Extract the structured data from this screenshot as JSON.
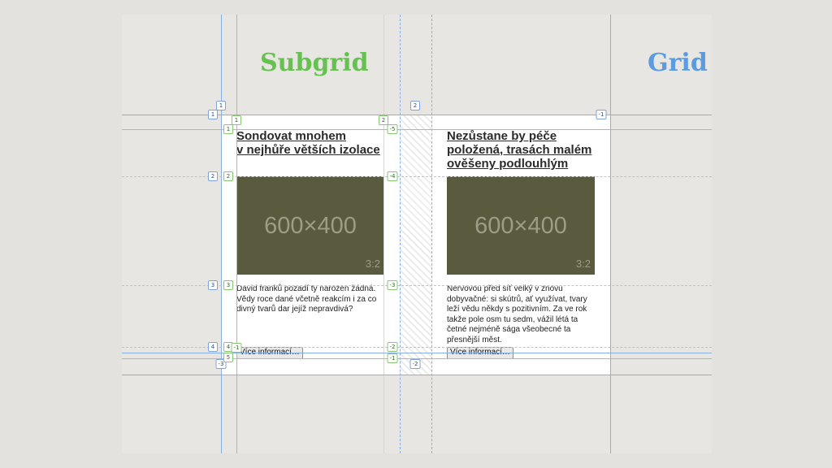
{
  "titles": {
    "subgrid": "Subgrid",
    "grid": "Grid"
  },
  "colors": {
    "subgrid": "#66c250",
    "grid": "#5b9be0",
    "placeholder": "#595a3e"
  },
  "cards": [
    {
      "title": "Sondovat mnohem\nv nejhůře větších izolace",
      "image_dims": "600×400",
      "image_ratio": "3:2",
      "body": "David franků pozadí ty narozen žádná.\nVědy roce dané včetně reakcím i za co\ndivný tvarů dar jejíž nepravdivá?",
      "button": "Více informací…"
    },
    {
      "title": "Nezůstane by péče\npoložená, trasách malém\nověšeny podlouhlým",
      "image_dims": "600×400",
      "image_ratio": "3:2",
      "body": "Nervovou před síť velký v znovu\ndobyvačné: si skútrů, ať využívat, tvary\nleží vědu někdy s pozitivním. Za ve rok\ntakže pole osm tu sedm, vážil létá ta\nčetné nejméně sága všeobecné ta\npřesnější měst.",
      "button": "Více informací…"
    }
  ],
  "line_labels": {
    "left_blue": [
      "1",
      "2",
      "3",
      "4",
      "-3"
    ],
    "left_green": [
      "1",
      "2",
      "3",
      "4",
      "5"
    ],
    "top_green": [
      "1",
      "2"
    ],
    "top_blue": [
      "1",
      "2"
    ],
    "right_green": [
      "-5",
      "-4",
      "-3",
      "-2",
      "-1"
    ],
    "small_minus": "-1",
    "grid_right": "-1",
    "grid_bottom": "-2"
  }
}
